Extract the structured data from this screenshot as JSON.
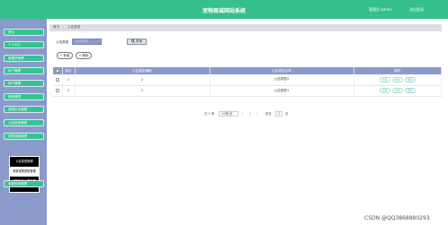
{
  "header": {
    "title": "宠物商城网站系统",
    "user": "管理员 admin",
    "logout": "退出登录"
  },
  "sidebar": {
    "items": [
      "首页",
      "个人中心",
      "管理员管理",
      "用户管理",
      "用户管理",
      "商家管理",
      "宠物论坛管理",
      "公告信息管理",
      "宠物商城管理",
      "商城系统管理"
    ],
    "submenu": [
      "公告类型管理",
      "商家宠物类型管理",
      "宠物商品分类管理"
    ]
  },
  "breadcrumb": {
    "home": "首页",
    "current": "公告类型"
  },
  "search": {
    "label": "公告类型",
    "placeholder": "公告类型",
    "button": "查询"
  },
  "actions": {
    "add": "新增",
    "delete": "删除"
  },
  "table": {
    "headers": [
      "",
      "索引",
      "公告类型编码",
      "公告类型名称",
      "操作"
    ],
    "rows": [
      {
        "index": "1",
        "code": "2",
        "name": "公告类型2"
      },
      {
        "index": "2",
        "code": "1",
        "name": "公告类型1"
      }
    ],
    "ops": [
      "详情",
      "修改",
      "删除"
    ]
  },
  "pager": {
    "total": "共 2 条",
    "size": "10条/页",
    "page": "1",
    "goto": "前往",
    "goto_page": "1",
    "unit": "页"
  },
  "watermark": "CSDN @QQ3868880293",
  "colors": {
    "header": "#36c08b",
    "sidebar": "#8a9acb",
    "menu_btn": "#37c38f"
  }
}
